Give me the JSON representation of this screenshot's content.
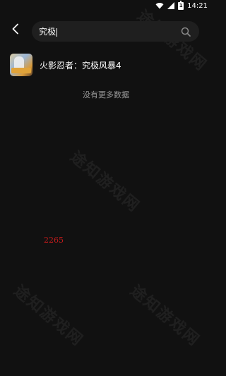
{
  "status_bar": {
    "time": "14:21",
    "battery_glyph": "1",
    "icons": [
      "wifi-icon",
      "signal-icon",
      "battery-icon"
    ]
  },
  "search": {
    "query": "究极",
    "back_icon": "back-chevron-icon",
    "search_icon": "search-icon"
  },
  "results": [
    {
      "title": "火影忍者：究极风暴4",
      "icon": "game-thumbnail"
    }
  ],
  "footer_message": "没有更多数据",
  "stray_text": "2265",
  "watermark": {
    "text": "途知游戏网"
  },
  "colors": {
    "background": "#111111",
    "search_box": "#1f1f1f",
    "muted_text": "#9a9a9a",
    "stray_number": "#c11b1b"
  }
}
